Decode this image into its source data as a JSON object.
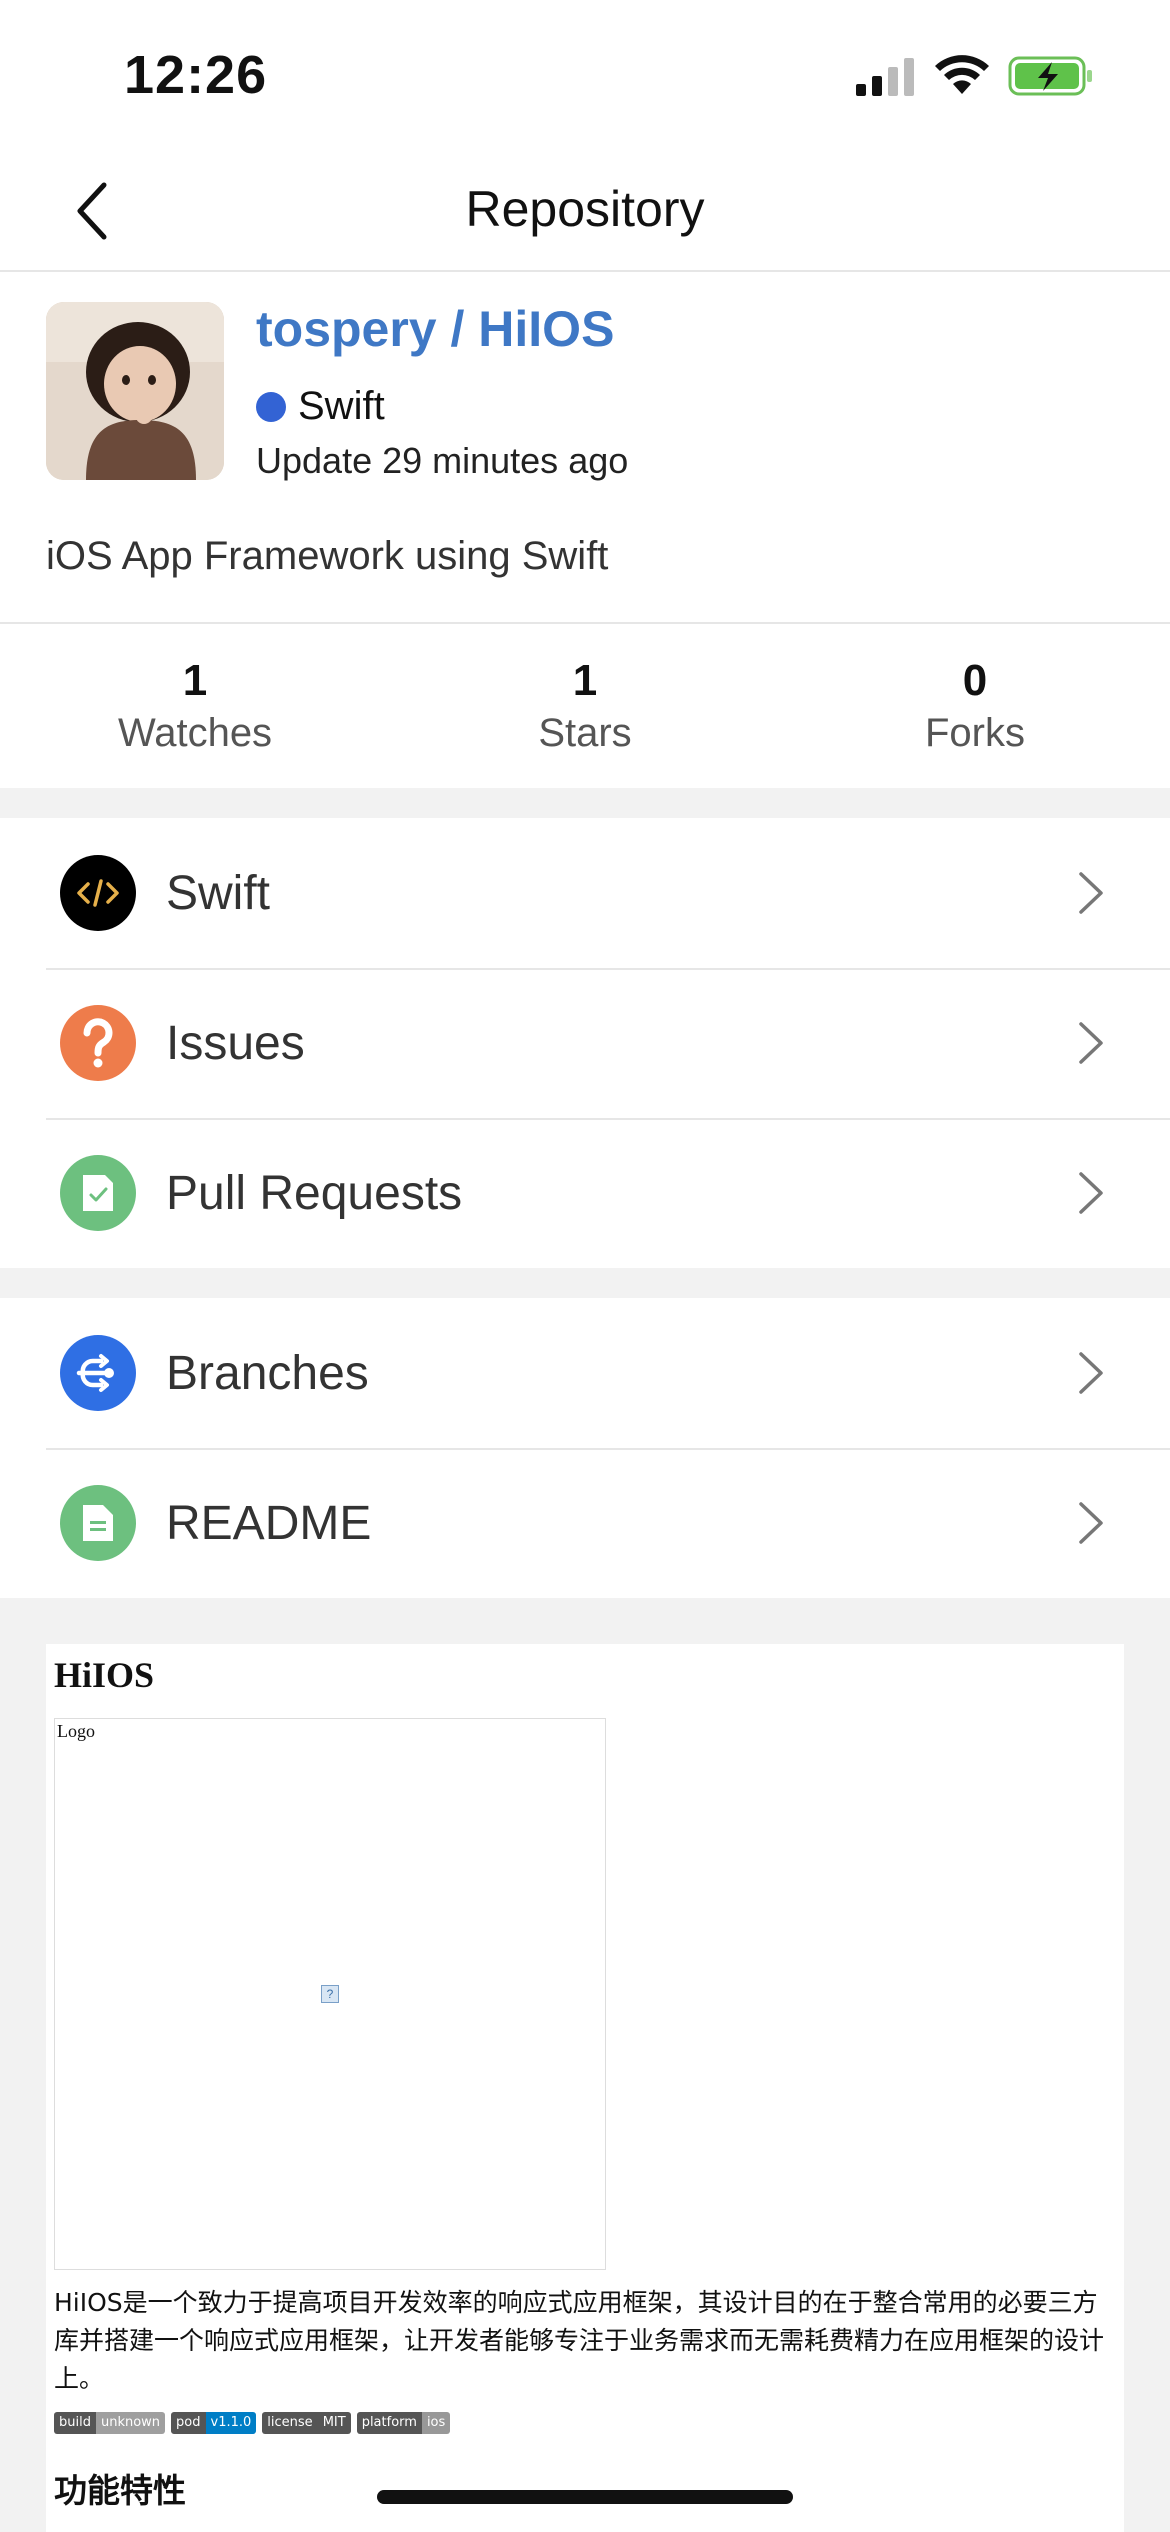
{
  "status_bar": {
    "time": "12:26"
  },
  "nav": {
    "title": "Repository"
  },
  "repo": {
    "name": "tospery / HiIOS",
    "language": "Swift",
    "language_color": "#3363d4",
    "updated": "Update 29 minutes ago",
    "description": "iOS App Framework using Swift"
  },
  "stats": [
    {
      "count": "1",
      "label": "Watches"
    },
    {
      "count": "1",
      "label": "Stars"
    },
    {
      "count": "0",
      "label": "Forks"
    }
  ],
  "menu_group_1": [
    {
      "label": "Swift",
      "icon": "code-icon",
      "color": "#000000"
    },
    {
      "label": "Issues",
      "icon": "question-icon",
      "color": "#ee7c4b"
    },
    {
      "label": "Pull Requests",
      "icon": "pull-request-icon",
      "color": "#6dc07f"
    }
  ],
  "menu_group_2": [
    {
      "label": "Branches",
      "icon": "branch-icon",
      "color": "#2f6fe4"
    },
    {
      "label": "README",
      "icon": "document-icon",
      "color": "#6dc07f"
    }
  ],
  "readme": {
    "title": "HiIOS",
    "logo_alt": "Logo",
    "intro": "HiIOS是一个致力于提高项目开发效率的响应式应用框架，其设计目的在于整合常用的必要三方库并搭建一个响应式应用框架，让开发者能够专注于业务需求而无需耗费精力在应用框架的设计上。",
    "badges": [
      {
        "key": "build",
        "value": "unknown",
        "color": "#9f9f9f"
      },
      {
        "key": "pod",
        "value": "v1.1.0",
        "color": "#007ec6"
      },
      {
        "key": "license",
        "value": "MIT",
        "color": "#555555"
      },
      {
        "key": "platform",
        "value": "ios",
        "color": "#989898"
      }
    ],
    "features_title": "功能特性"
  }
}
